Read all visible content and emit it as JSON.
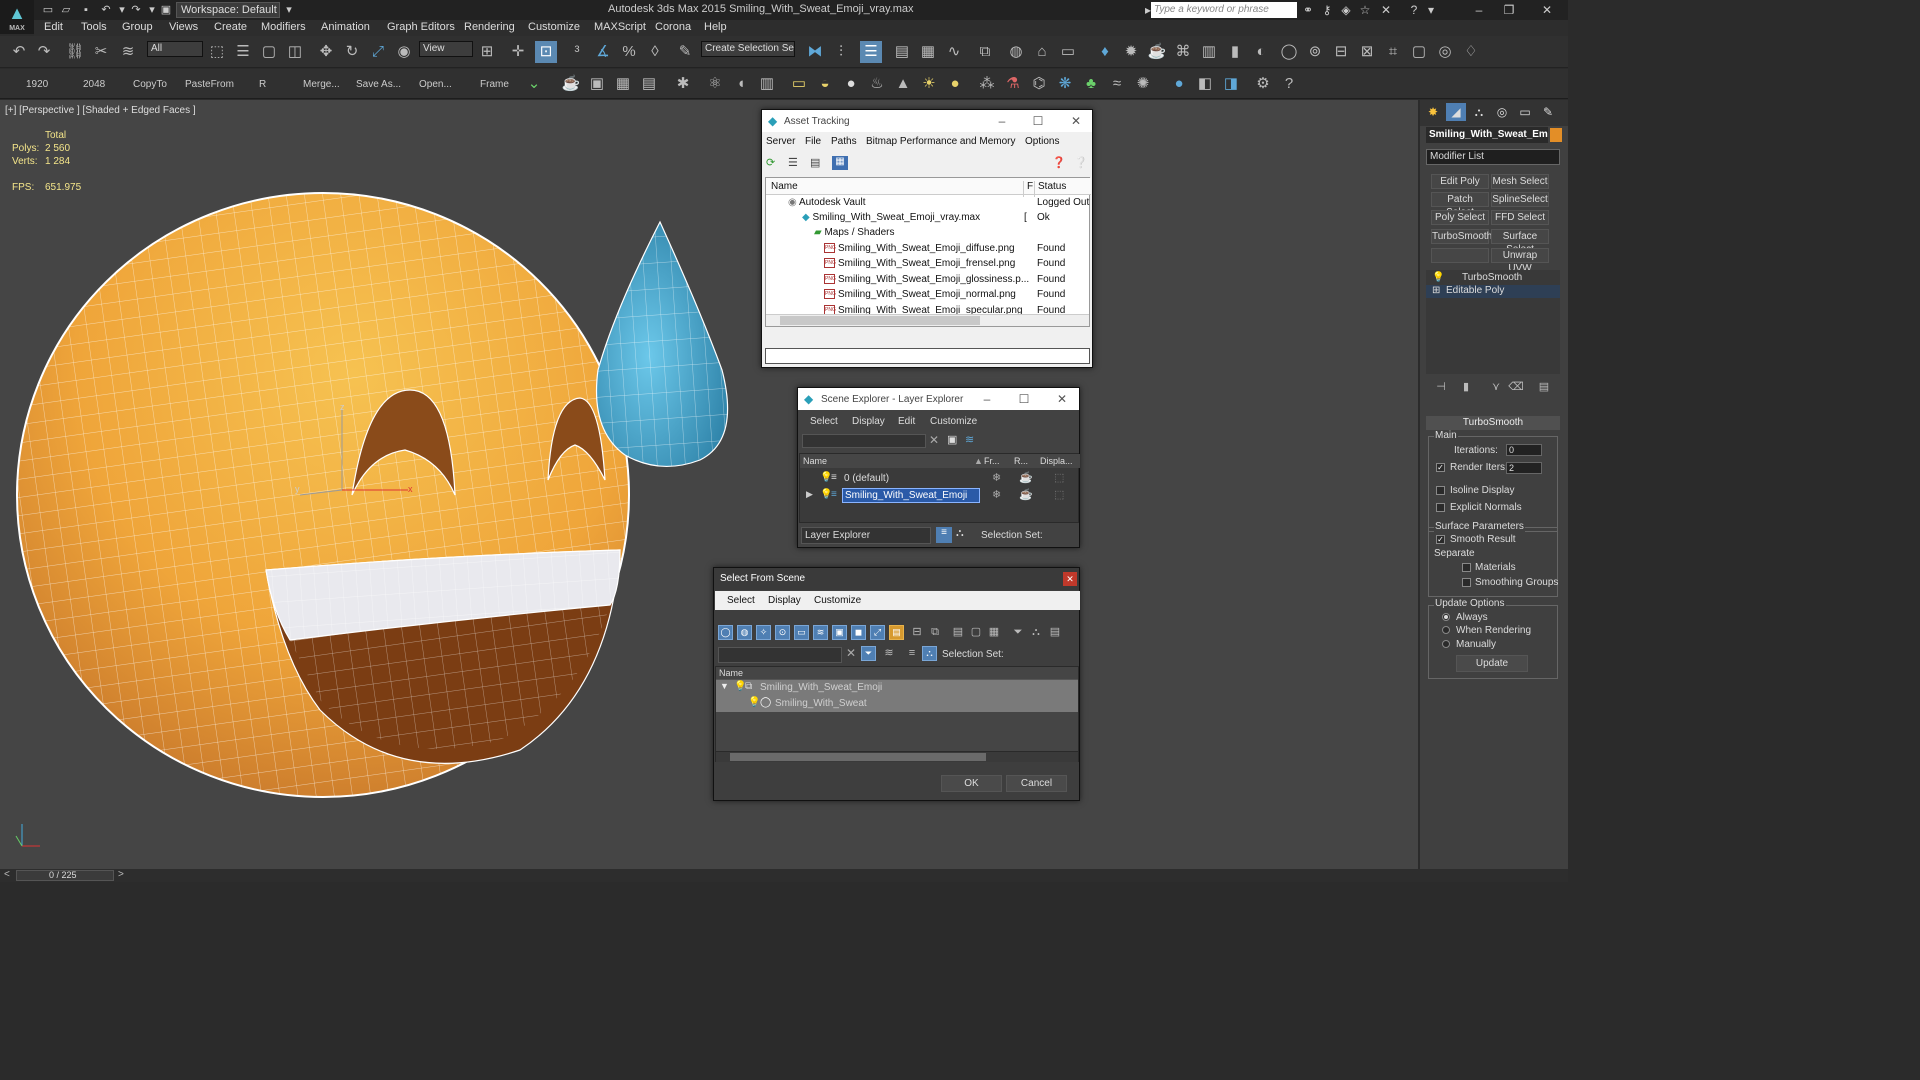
{
  "app": {
    "title": "Autodesk 3ds Max  2015     Smiling_With_Sweat_Emoji_vray.max",
    "logo_text": "MAX",
    "workspace": "Workspace: Default",
    "search_placeholder": "Type a keyword or phrase"
  },
  "menu": [
    "Edit",
    "Tools",
    "Group",
    "Views",
    "Create",
    "Modifiers",
    "Animation",
    "Graph Editors",
    "Rendering",
    "Customize",
    "MAXScript",
    "Corona",
    "Help"
  ],
  "toolbar": {
    "filter_value": "All",
    "view_value": "View",
    "selection_set_value": "Create Selection Se"
  },
  "scripts_bar": [
    "1920",
    "2048",
    "CopyTo",
    "PasteFrom",
    "R",
    "Merge...",
    "Save As...",
    "Open...",
    "Frame"
  ],
  "viewport": {
    "label": "[+] [Perspective ] [Shaded + Edged Faces ]",
    "stats": {
      "total_label": "Total",
      "polys_label": "Polys:",
      "polys_value": "2 560",
      "verts_label": "Verts:",
      "verts_value": "1 284",
      "fps_label": "FPS:",
      "fps_value": "651.975"
    },
    "gizmo": {
      "x": "x",
      "y": "y",
      "z": "z"
    }
  },
  "asset_tracking": {
    "title": "Asset Tracking",
    "menu": [
      "Server",
      "File",
      "Paths",
      "Bitmap Performance and Memory",
      "Options"
    ],
    "columns": [
      "Name",
      "F",
      "Status"
    ],
    "rows": [
      {
        "name": "Autodesk Vault",
        "f": "",
        "status": "Logged Out"
      },
      {
        "name": "Smiling_With_Sweat_Emoji_vray.max",
        "f": "[",
        "status": "Ok"
      },
      {
        "name": "Maps / Shaders",
        "f": "",
        "status": ""
      },
      {
        "name": "Smiling_With_Sweat_Emoji_diffuse.png",
        "f": "",
        "status": "Found"
      },
      {
        "name": "Smiling_With_Sweat_Emoji_frensel.png",
        "f": "",
        "status": "Found"
      },
      {
        "name": "Smiling_With_Sweat_Emoji_glossiness.p...",
        "f": "",
        "status": "Found"
      },
      {
        "name": "Smiling_With_Sweat_Emoji_normal.png",
        "f": "",
        "status": "Found"
      },
      {
        "name": "Smiling_With_Sweat_Emoji_specular.png",
        "f": "",
        "status": "Found"
      }
    ],
    "png_label": "PNG"
  },
  "scene_explorer": {
    "title": "Scene Explorer - Layer Explorer",
    "menu": [
      "Select",
      "Display",
      "Edit",
      "Customize"
    ],
    "columns": [
      "Name",
      "Fr...",
      "R...",
      "Displa..."
    ],
    "rows": [
      {
        "name": "0 (default)"
      },
      {
        "name": "Smiling_With_Sweat_Emoji"
      }
    ],
    "footer_dropdown": "Layer Explorer",
    "selection_set_label": "Selection Set:"
  },
  "select_from_scene": {
    "title": "Select From Scene",
    "menu": [
      "Select",
      "Display",
      "Customize"
    ],
    "column": "Name",
    "rows": [
      {
        "name": "Smiling_With_Sweat_Emoji"
      },
      {
        "name": "Smiling_With_Sweat"
      }
    ],
    "selection_set_label": "Selection Set:",
    "ok": "OK",
    "cancel": "Cancel"
  },
  "command_panel": {
    "object_name": "Smiling_With_Sweat_Em",
    "object_color": "#e38e27",
    "modifier_list": "Modifier List",
    "modifier_buttons": [
      "Edit Poly",
      "Mesh Select",
      "Patch Select",
      "SplineSelect",
      "Poly Select",
      "FFD Select",
      "TurboSmooth",
      "Surface Select",
      "",
      "Unwrap UVW"
    ],
    "stack": [
      "TurboSmooth",
      "Editable Poly"
    ],
    "turbosmooth": {
      "header": "TurboSmooth",
      "main_label": "Main",
      "iterations_label": "Iterations:",
      "iterations_value": "0",
      "render_iters_label": "Render Iters:",
      "render_iters_value": "2",
      "isoline_label": "Isoline Display",
      "explicit_normals_label": "Explicit Normals",
      "surface_params_label": "Surface Parameters",
      "smooth_result_label": "Smooth Result",
      "separate_label": "Separate",
      "materials_label": "Materials",
      "smoothing_groups_label": "Smoothing Groups",
      "update_options_label": "Update Options",
      "always_label": "Always",
      "when_rendering_label": "When Rendering",
      "manually_label": "Manually",
      "update_button": "Update"
    }
  },
  "status": {
    "timeline": "0 / 225"
  },
  "colors": {
    "emoji_face": "#f0a83a",
    "sweat_drop": "#3aa3cc",
    "selection": "#2a5aa8",
    "accent": "#5fa8d8"
  }
}
